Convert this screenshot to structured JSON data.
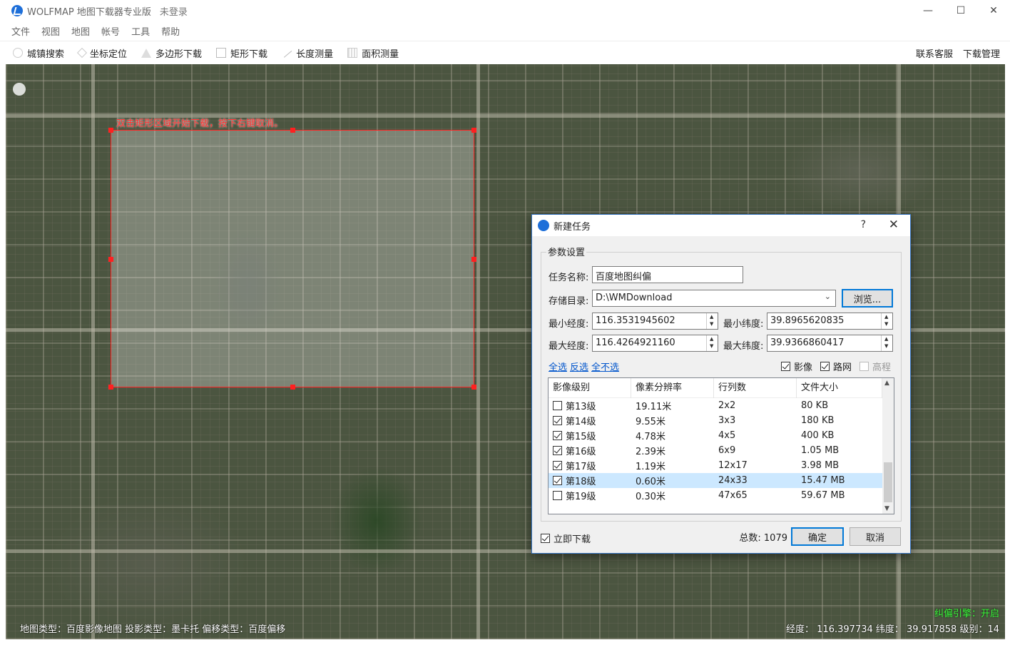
{
  "app": {
    "title": "WOLFMAP 地图下载器专业版",
    "login_status": "未登录"
  },
  "menu": [
    "文件",
    "视图",
    "地图",
    "帐号",
    "工具",
    "帮助"
  ],
  "toolbar": {
    "city_search": "城镇搜索",
    "coord_locate": "坐标定位",
    "polygon_download": "多边形下载",
    "rect_download": "矩形下载",
    "length_measure": "长度测量",
    "area_measure": "面积测量",
    "support": "联系客服",
    "download_manager": "下载管理"
  },
  "map": {
    "selection_hint": "双击矩形区域开始下载，按下右键取消。",
    "status_left": "地图类型：百度影像地图   投影类型：墨卡托   偏移类型：百度偏移",
    "engine_status": "纠偏引擎：开启",
    "status_right": "经度： 116.397734 纬度： 39.917858 级别：14"
  },
  "dialog": {
    "title": "新建任务",
    "help": "?",
    "close": "✕",
    "group_title": "参数设置",
    "task_name_label": "任务名称:",
    "task_name_value": "百度地图纠偏",
    "storage_label": "存储目录:",
    "storage_value": "D:\\WMDownload",
    "browse_label": "浏览...",
    "min_lng_label": "最小经度:",
    "min_lng_value": "116.3531945602",
    "min_lat_label": "最小纬度:",
    "min_lat_value": "39.8965620835",
    "max_lng_label": "最大经度:",
    "max_lng_value": "116.4264921160",
    "max_lat_label": "最大纬度:",
    "max_lat_value": "39.9366860417",
    "select_all": "全选",
    "invert": "反选",
    "select_none": "全不选",
    "layer_image": "影像",
    "layer_road": "路网",
    "layer_elevation": "高程",
    "columns": [
      "影像级别",
      "像素分辨率",
      "行列数",
      "文件大小"
    ],
    "rows": [
      {
        "level": "第13级",
        "res": "19.11米",
        "grid": "2x2",
        "size": "80 KB",
        "checked": false
      },
      {
        "level": "第14级",
        "res": "9.55米",
        "grid": "3x3",
        "size": "180 KB",
        "checked": true
      },
      {
        "level": "第15级",
        "res": "4.78米",
        "grid": "4x5",
        "size": "400 KB",
        "checked": true
      },
      {
        "level": "第16级",
        "res": "2.39米",
        "grid": "6x9",
        "size": "1.05 MB",
        "checked": true
      },
      {
        "level": "第17级",
        "res": "1.19米",
        "grid": "12x17",
        "size": "3.98 MB",
        "checked": true
      },
      {
        "level": "第18级",
        "res": "0.60米",
        "grid": "24x33",
        "size": "15.47 MB",
        "checked": true
      },
      {
        "level": "第19级",
        "res": "0.30米",
        "grid": "47x65",
        "size": "59.67 MB",
        "checked": false
      }
    ],
    "immediate_download": "立即下载",
    "total": "总数: 1079",
    "ok": "确定",
    "cancel": "取消"
  }
}
